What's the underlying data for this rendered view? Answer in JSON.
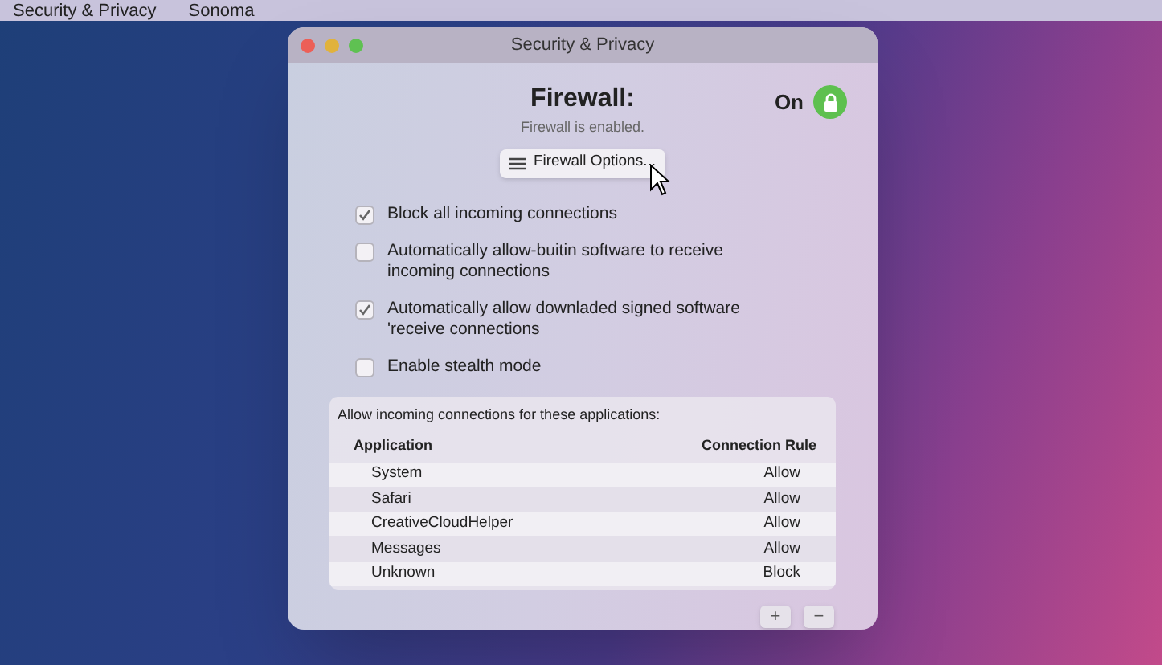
{
  "menu_bar": {
    "items": [
      "Security & Privacy",
      "Sonoma"
    ]
  },
  "window": {
    "title": "Security & Privacy"
  },
  "firewall": {
    "title": "Firewall:",
    "status": "Firewall is enabled.",
    "state_label": "On",
    "on": true,
    "options_button": "Firewall Options..."
  },
  "options": [
    {
      "label": "Block all incoming connections",
      "checked": true
    },
    {
      "label": "Automatically allow-buitin software to receive incoming connections",
      "checked": false
    },
    {
      "label": "Automatically allow downladed signed software 'receive connections",
      "checked": true
    },
    {
      "label": "Enable stealth mode",
      "checked": false
    }
  ],
  "apps_panel": {
    "caption": "Allow incoming connections for these applications:",
    "columns": [
      "Application",
      "Connection Rule"
    ],
    "rows": [
      {
        "application": "System",
        "rule": "Allow"
      },
      {
        "application": "Safari",
        "rule": "Allow"
      },
      {
        "application": "CreativeCloudHelper",
        "rule": "Allow"
      },
      {
        "application": "Messages",
        "rule": "Allow"
      },
      {
        "application": "Unknown",
        "rule": "Block"
      }
    ],
    "buttons": [
      "+",
      "−"
    ]
  }
}
